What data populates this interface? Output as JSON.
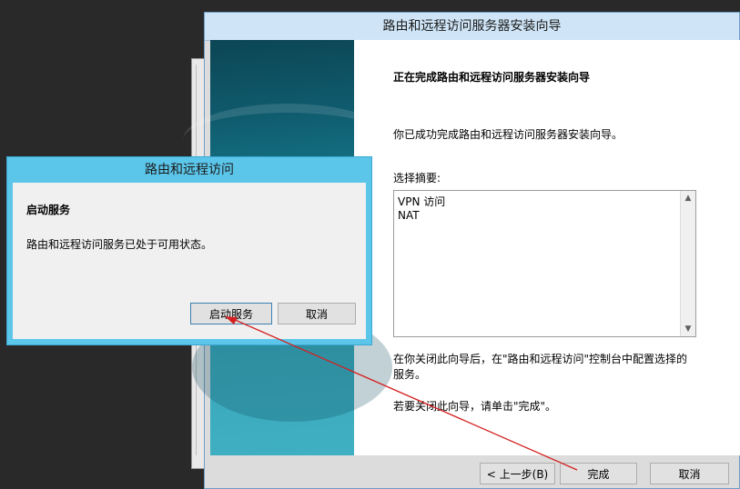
{
  "wizard": {
    "title": "路由和远程访问服务器安装向导",
    "heading": "正在完成路由和远程访问服务器安装向导",
    "success_text": "你已成功完成路由和远程访问服务器安装向导。",
    "summary_label": "选择摘要:",
    "summary_items": [
      "VPN 访问",
      "NAT"
    ],
    "note_lines": [
      "在你关闭此向导后，在\"路由和远程访问\"控制台中配置选择的",
      "服务。"
    ],
    "finish_hint": "若要关闭此向导，请单击\"完成\"。",
    "buttons": {
      "back": "< 上一步(B)",
      "finish": "完成",
      "cancel": "取消"
    }
  },
  "dialog": {
    "title": "路由和远程访问",
    "heading": "启动服务",
    "message": "路由和远程访问服务已处于可用状态。",
    "buttons": {
      "start": "启动服务",
      "cancel": "取消"
    }
  },
  "colors": {
    "dialog_frame": "#5bc6ea",
    "wizard_titlebar": "#cfe5f7",
    "annotation_arrow": "#d42020"
  }
}
